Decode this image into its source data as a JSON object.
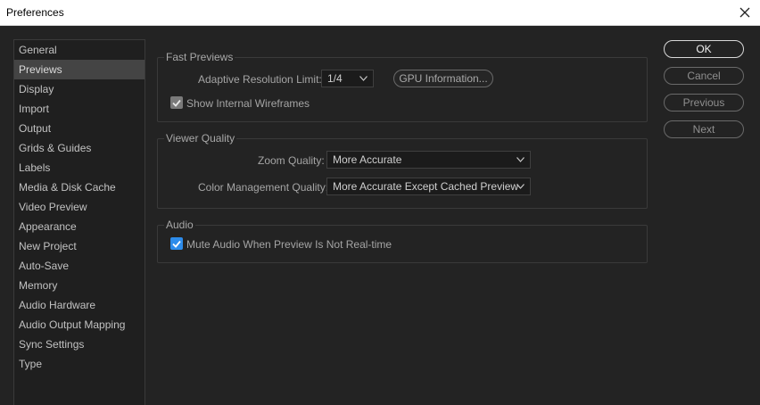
{
  "window": {
    "title": "Preferences"
  },
  "sidebar": {
    "items": [
      {
        "label": "General"
      },
      {
        "label": "Previews",
        "selected": true
      },
      {
        "label": "Display"
      },
      {
        "label": "Import"
      },
      {
        "label": "Output"
      },
      {
        "label": "Grids & Guides"
      },
      {
        "label": "Labels"
      },
      {
        "label": "Media & Disk Cache"
      },
      {
        "label": "Video Preview"
      },
      {
        "label": "Appearance"
      },
      {
        "label": "New Project"
      },
      {
        "label": "Auto-Save"
      },
      {
        "label": "Memory"
      },
      {
        "label": "Audio Hardware"
      },
      {
        "label": "Audio Output Mapping"
      },
      {
        "label": "Sync Settings"
      },
      {
        "label": "Type"
      }
    ]
  },
  "fast_previews": {
    "title": "Fast Previews",
    "resolution_label": "Adaptive Resolution Limit:",
    "resolution_value": "1/4",
    "gpu_button": "GPU Information...",
    "wireframes_label": "Show Internal Wireframes",
    "wireframes_checked": true
  },
  "viewer_quality": {
    "title": "Viewer Quality",
    "zoom_label": "Zoom Quality:",
    "zoom_value": "More Accurate",
    "color_label": "Color Management Quality:",
    "color_value": "More Accurate Except Cached Preview"
  },
  "audio": {
    "title": "Audio",
    "mute_label": "Mute Audio When Preview Is Not Real-time",
    "mute_checked": true
  },
  "actions": {
    "ok": "OK",
    "cancel": "Cancel",
    "previous": "Previous",
    "next": "Next"
  },
  "colors": {
    "background": "#232323",
    "selected_item": "#444444",
    "checkbox_accent": "#2d8ceb"
  }
}
